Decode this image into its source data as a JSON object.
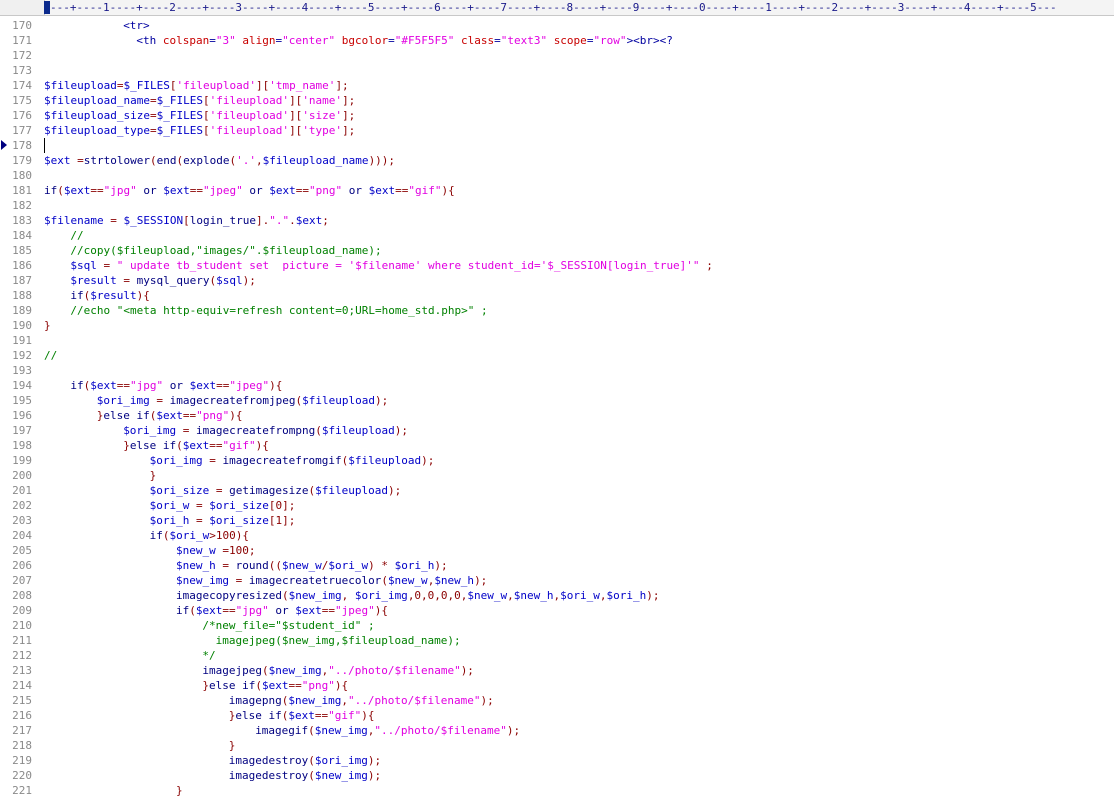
{
  "ruler": "---+----1----+----2----+----3----+----4----+----5----+----6----+----7----+----8----+----9----+----0----+----1----+----2----+----3----+----4----+----5---",
  "current_line": 178,
  "lines": [
    {
      "n": "170",
      "indent": 12,
      "tokens": [
        [
          "h",
          "<tr>"
        ]
      ]
    },
    {
      "n": "171",
      "indent": 14,
      "tokens": [
        [
          "h",
          "<th "
        ],
        [
          "a",
          "colspan"
        ],
        [
          "h",
          "="
        ],
        [
          "s",
          "\"3\""
        ],
        [
          "h",
          " "
        ],
        [
          "a",
          "align"
        ],
        [
          "h",
          "="
        ],
        [
          "s",
          "\"center\""
        ],
        [
          "h",
          " "
        ],
        [
          "a",
          "bgcolor"
        ],
        [
          "h",
          "="
        ],
        [
          "s",
          "\"#F5F5F5\""
        ],
        [
          "h",
          " "
        ],
        [
          "a",
          "class"
        ],
        [
          "h",
          "="
        ],
        [
          "s",
          "\"text3\""
        ],
        [
          "h",
          " "
        ],
        [
          "a",
          "scope"
        ],
        [
          "h",
          "="
        ],
        [
          "s",
          "\"row\""
        ],
        [
          "h",
          "><br><?"
        ]
      ]
    },
    {
      "n": "172",
      "indent": 0,
      "tokens": []
    },
    {
      "n": "173",
      "indent": 0,
      "tokens": []
    },
    {
      "n": "174",
      "indent": 0,
      "tokens": [
        [
          "v",
          "$fileupload"
        ],
        [
          "p",
          "="
        ],
        [
          "v",
          "$_FILES"
        ],
        [
          "p",
          "["
        ],
        [
          "s",
          "'fileupload'"
        ],
        [
          "p",
          "]["
        ],
        [
          "s",
          "'tmp_name'"
        ],
        [
          "p",
          "];"
        ]
      ]
    },
    {
      "n": "175",
      "indent": 0,
      "tokens": [
        [
          "v",
          "$fileupload_name"
        ],
        [
          "p",
          "="
        ],
        [
          "v",
          "$_FILES"
        ],
        [
          "p",
          "["
        ],
        [
          "s",
          "'fileupload'"
        ],
        [
          "p",
          "]["
        ],
        [
          "s",
          "'name'"
        ],
        [
          "p",
          "];"
        ]
      ]
    },
    {
      "n": "176",
      "indent": 0,
      "tokens": [
        [
          "v",
          "$fileupload_size"
        ],
        [
          "p",
          "="
        ],
        [
          "v",
          "$_FILES"
        ],
        [
          "p",
          "["
        ],
        [
          "s",
          "'fileupload'"
        ],
        [
          "p",
          "]["
        ],
        [
          "s",
          "'size'"
        ],
        [
          "p",
          "];"
        ]
      ]
    },
    {
      "n": "177",
      "indent": 0,
      "tokens": [
        [
          "v",
          "$fileupload_type"
        ],
        [
          "p",
          "="
        ],
        [
          "v",
          "$_FILES"
        ],
        [
          "p",
          "["
        ],
        [
          "s",
          "'fileupload'"
        ],
        [
          "p",
          "]["
        ],
        [
          "s",
          "'type'"
        ],
        [
          "p",
          "];"
        ]
      ]
    },
    {
      "n": "178",
      "indent": 0,
      "tokens": []
    },
    {
      "n": "179",
      "indent": 0,
      "tokens": [
        [
          "v",
          "$ext"
        ],
        [
          "k",
          " "
        ],
        [
          "p",
          "="
        ],
        [
          "k",
          "strtolower"
        ],
        [
          "p",
          "("
        ],
        [
          "k",
          "end"
        ],
        [
          "p",
          "("
        ],
        [
          "k",
          "explode"
        ],
        [
          "p",
          "("
        ],
        [
          "s",
          "'.'"
        ],
        [
          "p",
          ","
        ],
        [
          "v",
          "$fileupload_name"
        ],
        [
          "p",
          ")));"
        ]
      ]
    },
    {
      "n": "180",
      "indent": 0,
      "tokens": []
    },
    {
      "n": "181",
      "indent": 0,
      "tokens": [
        [
          "k",
          "if"
        ],
        [
          "p",
          "("
        ],
        [
          "v",
          "$ext"
        ],
        [
          "p",
          "=="
        ],
        [
          "s",
          "\"jpg\""
        ],
        [
          "k",
          " or "
        ],
        [
          "v",
          "$ext"
        ],
        [
          "p",
          "=="
        ],
        [
          "s",
          "\"jpeg\""
        ],
        [
          "k",
          " or "
        ],
        [
          "v",
          "$ext"
        ],
        [
          "p",
          "=="
        ],
        [
          "s",
          "\"png\""
        ],
        [
          "k",
          " or "
        ],
        [
          "v",
          "$ext"
        ],
        [
          "p",
          "=="
        ],
        [
          "s",
          "\"gif\""
        ],
        [
          "p",
          "){"
        ]
      ]
    },
    {
      "n": "182",
      "indent": 0,
      "tokens": []
    },
    {
      "n": "183",
      "indent": 0,
      "tokens": [
        [
          "v",
          "$filename"
        ],
        [
          "k",
          " "
        ],
        [
          "p",
          "="
        ],
        [
          "k",
          " "
        ],
        [
          "v",
          "$_SESSION"
        ],
        [
          "p",
          "["
        ],
        [
          "k",
          "login_true"
        ],
        [
          "p",
          "]."
        ],
        [
          "s",
          "\".\""
        ],
        [
          "p",
          "."
        ],
        [
          "v",
          "$ext"
        ],
        [
          "p",
          ";"
        ]
      ]
    },
    {
      "n": "184",
      "indent": 4,
      "tokens": [
        [
          "c",
          "//"
        ]
      ]
    },
    {
      "n": "185",
      "indent": 4,
      "tokens": [
        [
          "c",
          "//copy($fileupload,\"images/\".$fileupload_name);"
        ]
      ]
    },
    {
      "n": "186",
      "indent": 4,
      "tokens": [
        [
          "v",
          "$sql"
        ],
        [
          "k",
          " "
        ],
        [
          "p",
          "="
        ],
        [
          "k",
          " "
        ],
        [
          "s",
          "\" update tb_student set  picture = '$filename' where student_id='$_SESSION[login_true]'\""
        ],
        [
          "k",
          " "
        ],
        [
          "p",
          ";"
        ]
      ]
    },
    {
      "n": "187",
      "indent": 4,
      "tokens": [
        [
          "v",
          "$result"
        ],
        [
          "k",
          " "
        ],
        [
          "p",
          "="
        ],
        [
          "k",
          " mysql_query"
        ],
        [
          "p",
          "("
        ],
        [
          "v",
          "$sql"
        ],
        [
          "p",
          ");"
        ]
      ]
    },
    {
      "n": "188",
      "indent": 4,
      "tokens": [
        [
          "k",
          "if"
        ],
        [
          "p",
          "("
        ],
        [
          "v",
          "$result"
        ],
        [
          "p",
          "){"
        ]
      ]
    },
    {
      "n": "189",
      "indent": 4,
      "tokens": [
        [
          "c",
          "//echo \"<meta http-equiv=refresh content=0;URL=home_std.php>\" ;"
        ]
      ]
    },
    {
      "n": "190",
      "indent": 0,
      "tokens": [
        [
          "p",
          "}"
        ]
      ]
    },
    {
      "n": "191",
      "indent": 0,
      "tokens": []
    },
    {
      "n": "192",
      "indent": 0,
      "tokens": [
        [
          "c",
          "//"
        ]
      ]
    },
    {
      "n": "193",
      "indent": 0,
      "tokens": []
    },
    {
      "n": "194",
      "indent": 4,
      "tokens": [
        [
          "k",
          "if"
        ],
        [
          "p",
          "("
        ],
        [
          "v",
          "$ext"
        ],
        [
          "p",
          "=="
        ],
        [
          "s",
          "\"jpg\""
        ],
        [
          "k",
          " or "
        ],
        [
          "v",
          "$ext"
        ],
        [
          "p",
          "=="
        ],
        [
          "s",
          "\"jpeg\""
        ],
        [
          "p",
          "){"
        ]
      ]
    },
    {
      "n": "195",
      "indent": 8,
      "tokens": [
        [
          "v",
          "$ori_img"
        ],
        [
          "k",
          " "
        ],
        [
          "p",
          "="
        ],
        [
          "k",
          " imagecreatefromjpeg"
        ],
        [
          "p",
          "("
        ],
        [
          "v",
          "$fileupload"
        ],
        [
          "p",
          ");"
        ]
      ]
    },
    {
      "n": "196",
      "indent": 8,
      "tokens": [
        [
          "p",
          "}"
        ],
        [
          "k",
          "else if"
        ],
        [
          "p",
          "("
        ],
        [
          "v",
          "$ext"
        ],
        [
          "p",
          "=="
        ],
        [
          "s",
          "\"png\""
        ],
        [
          "p",
          "){"
        ]
      ]
    },
    {
      "n": "197",
      "indent": 12,
      "tokens": [
        [
          "v",
          "$ori_img"
        ],
        [
          "k",
          " "
        ],
        [
          "p",
          "="
        ],
        [
          "k",
          " imagecreatefrompng"
        ],
        [
          "p",
          "("
        ],
        [
          "v",
          "$fileupload"
        ],
        [
          "p",
          ");"
        ]
      ]
    },
    {
      "n": "198",
      "indent": 12,
      "tokens": [
        [
          "p",
          "}"
        ],
        [
          "k",
          "else if"
        ],
        [
          "p",
          "("
        ],
        [
          "v",
          "$ext"
        ],
        [
          "p",
          "=="
        ],
        [
          "s",
          "\"gif\""
        ],
        [
          "p",
          "){"
        ]
      ]
    },
    {
      "n": "199",
      "indent": 16,
      "tokens": [
        [
          "v",
          "$ori_img"
        ],
        [
          "k",
          " "
        ],
        [
          "p",
          "="
        ],
        [
          "k",
          " imagecreatefromgif"
        ],
        [
          "p",
          "("
        ],
        [
          "v",
          "$fileupload"
        ],
        [
          "p",
          ");"
        ]
      ]
    },
    {
      "n": "200",
      "indent": 16,
      "tokens": [
        [
          "p",
          "}"
        ]
      ]
    },
    {
      "n": "201",
      "indent": 16,
      "tokens": [
        [
          "v",
          "$ori_size"
        ],
        [
          "k",
          " "
        ],
        [
          "p",
          "="
        ],
        [
          "k",
          " getimagesize"
        ],
        [
          "p",
          "("
        ],
        [
          "v",
          "$fileupload"
        ],
        [
          "p",
          ");"
        ]
      ]
    },
    {
      "n": "202",
      "indent": 16,
      "tokens": [
        [
          "v",
          "$ori_w"
        ],
        [
          "k",
          " "
        ],
        [
          "p",
          "="
        ],
        [
          "k",
          " "
        ],
        [
          "v",
          "$ori_size"
        ],
        [
          "p",
          "[0];"
        ]
      ]
    },
    {
      "n": "203",
      "indent": 16,
      "tokens": [
        [
          "v",
          "$ori_h"
        ],
        [
          "k",
          " "
        ],
        [
          "p",
          "="
        ],
        [
          "k",
          " "
        ],
        [
          "v",
          "$ori_size"
        ],
        [
          "p",
          "[1];"
        ]
      ]
    },
    {
      "n": "204",
      "indent": 16,
      "tokens": [
        [
          "k",
          "if"
        ],
        [
          "p",
          "("
        ],
        [
          "v",
          "$ori_w"
        ],
        [
          "p",
          ">100){"
        ]
      ]
    },
    {
      "n": "205",
      "indent": 20,
      "tokens": [
        [
          "v",
          "$new_w"
        ],
        [
          "k",
          " "
        ],
        [
          "p",
          "=100;"
        ]
      ]
    },
    {
      "n": "206",
      "indent": 20,
      "tokens": [
        [
          "v",
          "$new_h"
        ],
        [
          "k",
          " "
        ],
        [
          "p",
          "="
        ],
        [
          "k",
          " round"
        ],
        [
          "p",
          "(("
        ],
        [
          "v",
          "$new_w"
        ],
        [
          "p",
          "/"
        ],
        [
          "v",
          "$ori_w"
        ],
        [
          "p",
          ")"
        ],
        [
          "k",
          " "
        ],
        [
          "p",
          "*"
        ],
        [
          "k",
          " "
        ],
        [
          "v",
          "$ori_h"
        ],
        [
          "p",
          ");"
        ]
      ]
    },
    {
      "n": "207",
      "indent": 20,
      "tokens": [
        [
          "v",
          "$new_img"
        ],
        [
          "k",
          " "
        ],
        [
          "p",
          "="
        ],
        [
          "k",
          " imagecreatetruecolor"
        ],
        [
          "p",
          "("
        ],
        [
          "v",
          "$new_w"
        ],
        [
          "p",
          ","
        ],
        [
          "v",
          "$new_h"
        ],
        [
          "p",
          ");"
        ]
      ]
    },
    {
      "n": "208",
      "indent": 20,
      "tokens": [
        [
          "k",
          "imagecopyresized"
        ],
        [
          "p",
          "("
        ],
        [
          "v",
          "$new_img"
        ],
        [
          "p",
          ", "
        ],
        [
          "v",
          "$ori_img"
        ],
        [
          "p",
          ",0,0,0,0,"
        ],
        [
          "v",
          "$new_w"
        ],
        [
          "p",
          ","
        ],
        [
          "v",
          "$new_h"
        ],
        [
          "p",
          ","
        ],
        [
          "v",
          "$ori_w"
        ],
        [
          "p",
          ","
        ],
        [
          "v",
          "$ori_h"
        ],
        [
          "p",
          ");"
        ]
      ]
    },
    {
      "n": "209",
      "indent": 20,
      "tokens": [
        [
          "k",
          "if"
        ],
        [
          "p",
          "("
        ],
        [
          "v",
          "$ext"
        ],
        [
          "p",
          "=="
        ],
        [
          "s",
          "\"jpg\""
        ],
        [
          "k",
          " or "
        ],
        [
          "v",
          "$ext"
        ],
        [
          "p",
          "=="
        ],
        [
          "s",
          "\"jpeg\""
        ],
        [
          "p",
          "){"
        ]
      ]
    },
    {
      "n": "210",
      "indent": 24,
      "tokens": [
        [
          "c",
          "/*new_file=\"$student_id\" ;"
        ]
      ]
    },
    {
      "n": "211",
      "indent": 24,
      "tokens": [
        [
          "c",
          "  imagejpeg($new_img,$fileupload_name);"
        ]
      ]
    },
    {
      "n": "212",
      "indent": 24,
      "tokens": [
        [
          "c",
          "*/"
        ]
      ]
    },
    {
      "n": "213",
      "indent": 24,
      "tokens": [
        [
          "k",
          "imagejpeg"
        ],
        [
          "p",
          "("
        ],
        [
          "v",
          "$new_img"
        ],
        [
          "p",
          ","
        ],
        [
          "s",
          "\"../photo/$filename\""
        ],
        [
          "p",
          ");"
        ]
      ]
    },
    {
      "n": "214",
      "indent": 24,
      "tokens": [
        [
          "p",
          "}"
        ],
        [
          "k",
          "else if"
        ],
        [
          "p",
          "("
        ],
        [
          "v",
          "$ext"
        ],
        [
          "p",
          "=="
        ],
        [
          "s",
          "\"png\""
        ],
        [
          "p",
          "){"
        ]
      ]
    },
    {
      "n": "215",
      "indent": 28,
      "tokens": [
        [
          "k",
          "imagepng"
        ],
        [
          "p",
          "("
        ],
        [
          "v",
          "$new_img"
        ],
        [
          "p",
          ","
        ],
        [
          "s",
          "\"../photo/$filename\""
        ],
        [
          "p",
          ");"
        ]
      ]
    },
    {
      "n": "216",
      "indent": 28,
      "tokens": [
        [
          "p",
          "}"
        ],
        [
          "k",
          "else if"
        ],
        [
          "p",
          "("
        ],
        [
          "v",
          "$ext"
        ],
        [
          "p",
          "=="
        ],
        [
          "s",
          "\"gif\""
        ],
        [
          "p",
          "){"
        ]
      ]
    },
    {
      "n": "217",
      "indent": 32,
      "tokens": [
        [
          "k",
          "imagegif"
        ],
        [
          "p",
          "("
        ],
        [
          "v",
          "$new_img"
        ],
        [
          "p",
          ","
        ],
        [
          "s",
          "\"../photo/$filename\""
        ],
        [
          "p",
          ");"
        ]
      ]
    },
    {
      "n": "218",
      "indent": 28,
      "tokens": [
        [
          "p",
          "}"
        ]
      ]
    },
    {
      "n": "219",
      "indent": 28,
      "tokens": [
        [
          "k",
          "imagedestroy"
        ],
        [
          "p",
          "("
        ],
        [
          "v",
          "$ori_img"
        ],
        [
          "p",
          ");"
        ]
      ]
    },
    {
      "n": "220",
      "indent": 28,
      "tokens": [
        [
          "k",
          "imagedestroy"
        ],
        [
          "p",
          "("
        ],
        [
          "v",
          "$new_img"
        ],
        [
          "p",
          ");"
        ]
      ]
    },
    {
      "n": "221",
      "indent": 20,
      "tokens": [
        [
          "p",
          "}"
        ]
      ]
    }
  ]
}
